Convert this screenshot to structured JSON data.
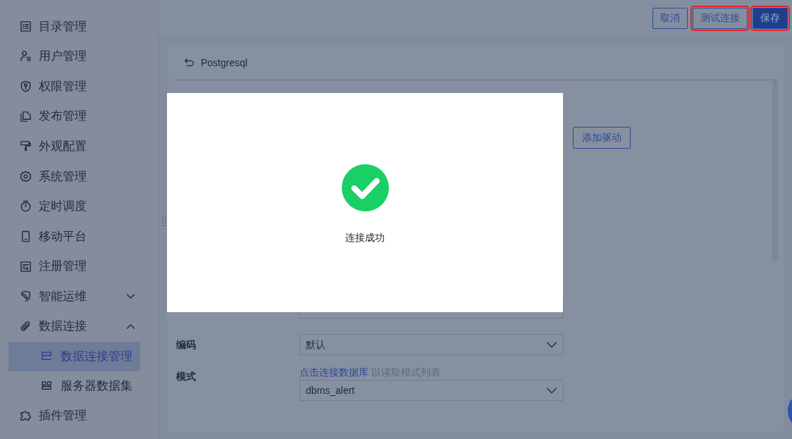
{
  "sidebar": {
    "items": [
      {
        "label": "目录管理",
        "selected": false
      },
      {
        "label": "用户管理",
        "selected": false
      },
      {
        "label": "权限管理",
        "selected": false
      },
      {
        "label": "发布管理",
        "selected": false
      },
      {
        "label": "外观配置",
        "selected": false
      },
      {
        "label": "系统管理",
        "selected": false
      },
      {
        "label": "定时调度",
        "selected": false
      },
      {
        "label": "移动平台",
        "selected": false
      },
      {
        "label": "注册管理",
        "selected": false
      },
      {
        "label": "智能运维",
        "selected": false,
        "expanded": false
      },
      {
        "label": "数据连接",
        "selected": false,
        "expanded": true,
        "children": [
          {
            "label": "数据连接管理",
            "selected": true
          },
          {
            "label": "服务器数据集",
            "selected": false
          }
        ]
      },
      {
        "label": "插件管理",
        "selected": false
      }
    ]
  },
  "toolbar": {
    "buttons": [
      {
        "label": "取消",
        "kind": "outline",
        "highlighted": false
      },
      {
        "label": "测试连接",
        "kind": "outline",
        "highlighted": true
      },
      {
        "label": "保存",
        "kind": "primary",
        "highlighted": true
      }
    ]
  },
  "panel": {
    "title": "Postgresql",
    "driver_button": "添加驱动",
    "fields": [
      {
        "kind": "input"
      },
      {
        "kind": "select",
        "label": "编码",
        "value": "默认"
      },
      {
        "kind": "select",
        "label": "模式",
        "value": "dbms_alert",
        "hint_link": "点击连接数据库",
        "hint": "以读取模式列表"
      }
    ]
  },
  "dialog": {
    "kind": "success",
    "message": "连接成功"
  }
}
